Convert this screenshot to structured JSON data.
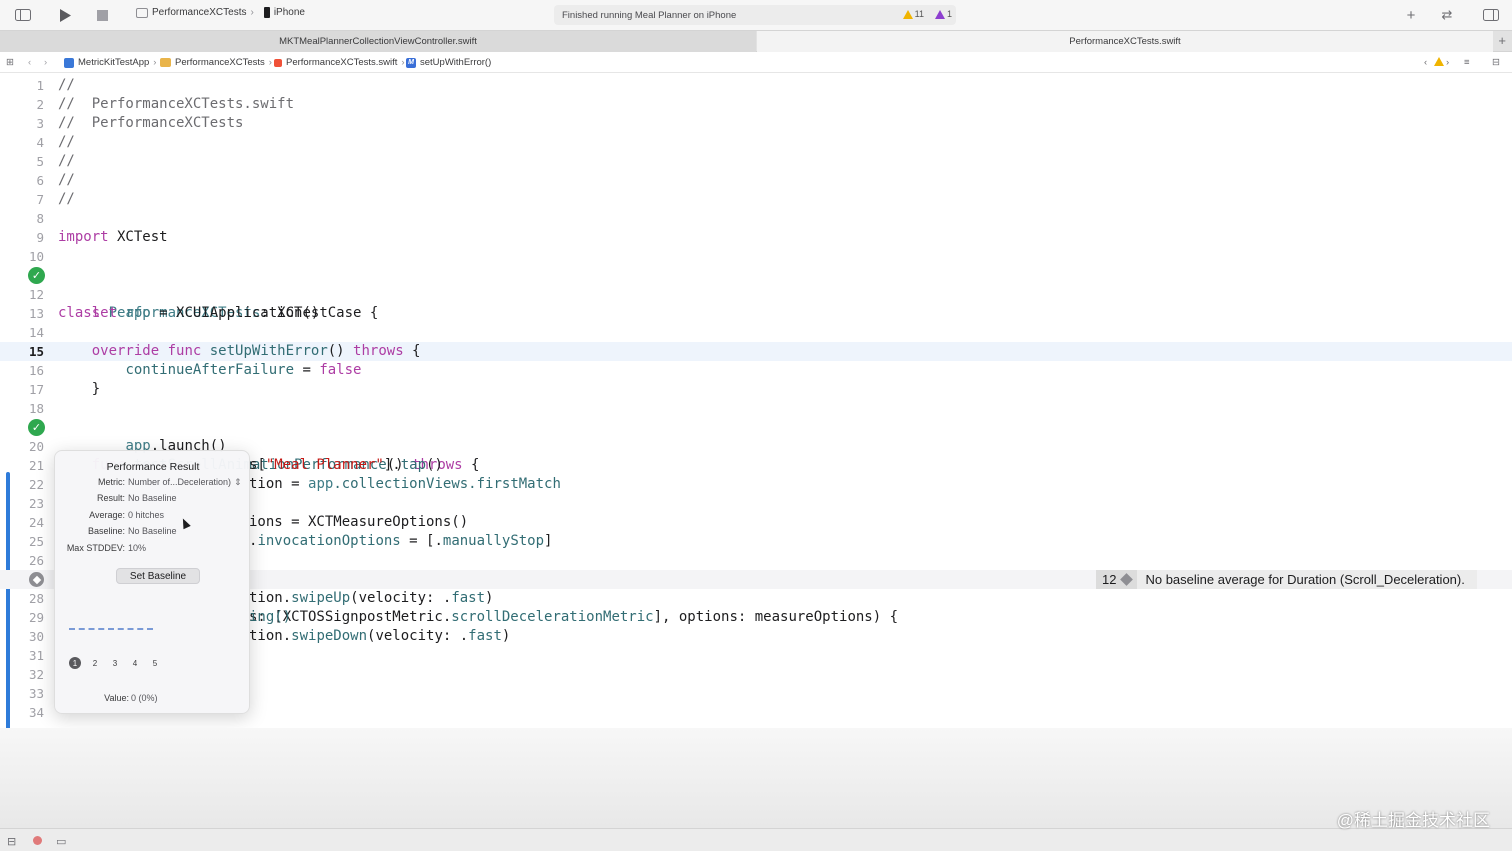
{
  "toolbar": {
    "scheme_target": "PerformanceXCTests",
    "device": "iPhone",
    "activity": "Finished running Meal Planner on iPhone",
    "warnings": "11",
    "errors": "1"
  },
  "tabs": [
    {
      "label": "MKTMealPlannerCollectionViewController.swift"
    },
    {
      "label": "PerformanceXCTests.swift"
    }
  ],
  "jumpbar": {
    "project": "MetricKitTestApp",
    "group": "PerformanceXCTests",
    "file": "PerformanceXCTests.swift",
    "symbol": "setUpWithError()"
  },
  "lines": [
    {
      "n": "1"
    },
    {
      "n": "2"
    },
    {
      "n": "3"
    },
    {
      "n": "4"
    },
    {
      "n": "5"
    },
    {
      "n": "6"
    },
    {
      "n": "7"
    },
    {
      "n": "8"
    },
    {
      "n": "9"
    },
    {
      "n": "10"
    },
    {
      "n": "11"
    },
    {
      "n": "12"
    },
    {
      "n": "13"
    },
    {
      "n": "14"
    },
    {
      "n": "15"
    },
    {
      "n": "16"
    },
    {
      "n": "17"
    },
    {
      "n": "18"
    },
    {
      "n": "19"
    },
    {
      "n": "20"
    },
    {
      "n": "21"
    },
    {
      "n": "22"
    },
    {
      "n": "23"
    },
    {
      "n": "24"
    },
    {
      "n": "25"
    },
    {
      "n": "26"
    },
    {
      "n": "27"
    },
    {
      "n": "28"
    },
    {
      "n": "29"
    },
    {
      "n": "30"
    },
    {
      "n": "31"
    },
    {
      "n": "32"
    },
    {
      "n": "33"
    },
    {
      "n": "34"
    }
  ],
  "code": {
    "l1": "//",
    "l2": "//  PerformanceXCTests.swift",
    "l3": "//  PerformanceXCTests",
    "l4": "//",
    "l5": "//",
    "l6": "//",
    "l7": "//",
    "l9_kw": "import",
    "l9_rest": " XCTest",
    "l11_kw": "class",
    "l11_name": " PerformanceXCTests",
    "l11_rest": ": XCTestCase {",
    "l13_kw": "let",
    "l13_var": " app",
    "l13_rest": " = XCUIApplication()",
    "l15_kw1": "override",
    "l15_kw2": " func",
    "l15_fn": " setUpWithError",
    "l15_mid": "() ",
    "l15_kw3": "throws",
    "l15_end": " {",
    "l16_var": "continueAfterFailure",
    "l16_mid": " = ",
    "l16_kw": "false",
    "l17": "}",
    "l19_kw": "func",
    "l19_fn": " testScrollAnimationPerformance",
    "l19_mid": "() ",
    "l19_kw2": "throws",
    "l19_end": " {",
    "l20_var": "app",
    "l20_rest": ".launch()",
    "l21_pre": "s[",
    "l21_str": "\"Meal Planner\"",
    "l21_mid": "].",
    "l21_fn": "tap",
    "l21_end": "()",
    "l22_pre": "tion = ",
    "l22_var": "app",
    "l22_rest": ".collectionViews.firstMatch",
    "l24_pre": "ions = XCTMeasureOptions()",
    "l25_pre": ".",
    "l25_var": "invocationOptions",
    "l25_mid": " = [.",
    "l25_val": "manuallyStop",
    "l25_end": "]",
    "l27_pre": "s: [XCTOSSignpostMetric.",
    "l27_var": "scrollDecelerationMetric",
    "l27_rest": "], options: measureOptions) {",
    "l28_pre": "tion.",
    "l28_fn": "swipeUp",
    "l28_mid": "(velocity: .",
    "l28_val": "fast",
    "l28_end": ")",
    "l29_pre": "ing()",
    "l30_pre": "tion.",
    "l30_fn": "swipeDown",
    "l30_mid": "(velocity: .",
    "l30_val": "fast",
    "l30_end": ")"
  },
  "issue": {
    "count": "12",
    "message": "No baseline average for Duration (Scroll_Deceleration)."
  },
  "popover": {
    "title": "Performance Result",
    "metric_label": "Metric:",
    "metric_value": "Number of...Deceleration)",
    "result_label": "Result:",
    "result_value": "No Baseline",
    "average_label": "Average:",
    "average_value": "0 hitches",
    "baseline_label": "Baseline:",
    "baseline_value": "No Baseline",
    "stddev_label": "Max STDDEV:",
    "stddev_value": "10%",
    "set_baseline": "Set Baseline",
    "runs": [
      "1",
      "2",
      "3",
      "4",
      "5"
    ],
    "value_label": "Value:",
    "value_value": "0 (0%)"
  },
  "watermark": "@稀土掘金技术社区",
  "colors": {
    "accent": "#2e7bd9",
    "keyword": "#ad3da4",
    "string": "#c41a16",
    "success": "#2fa84f"
  }
}
